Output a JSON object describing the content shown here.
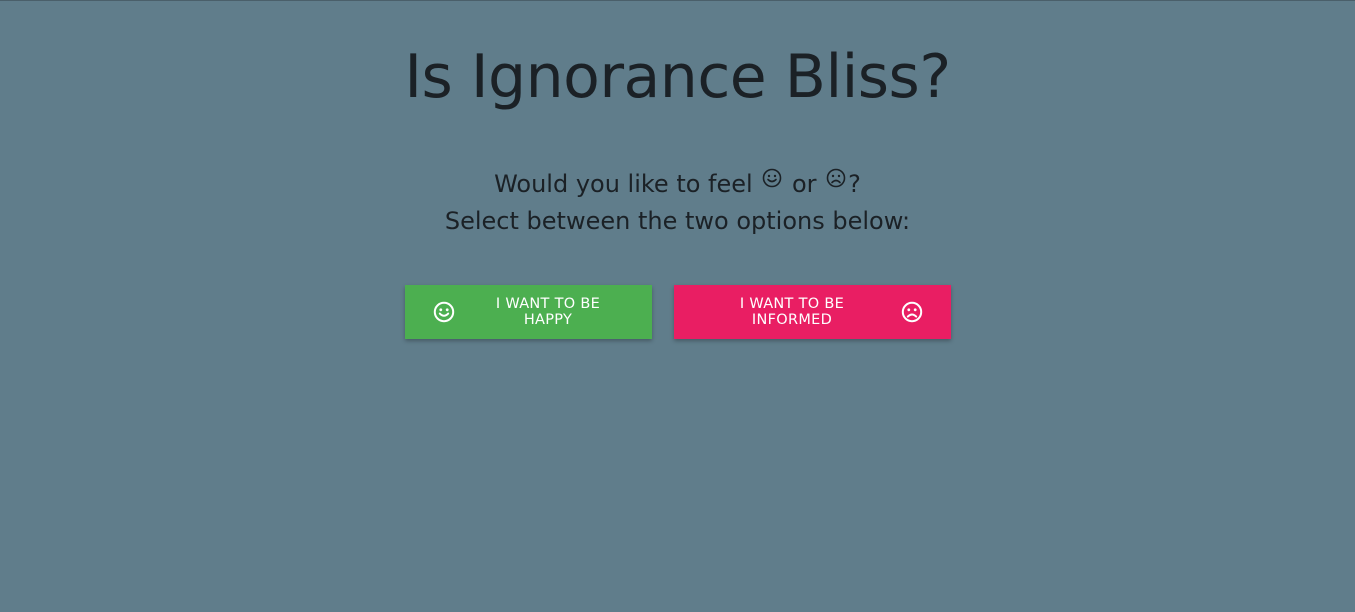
{
  "page": {
    "title": "Is Ignorance Bliss?",
    "subtitle_line1_prefix": "Would you like to feel",
    "subtitle_line1_or": "or",
    "subtitle_line1_suffix": "?",
    "subtitle_line2": "Select between the two options below:"
  },
  "buttons": {
    "happy_label": "I WANT TO BE HAPPY",
    "happy_icon": "smile-icon",
    "informed_label": "I WANT TO BE INFORMED",
    "informed_icon": "frown-icon"
  },
  "colors": {
    "background": "#607d8b",
    "happy_button": "#4caf50",
    "informed_button": "#e91e63",
    "text": "#1b2126"
  }
}
